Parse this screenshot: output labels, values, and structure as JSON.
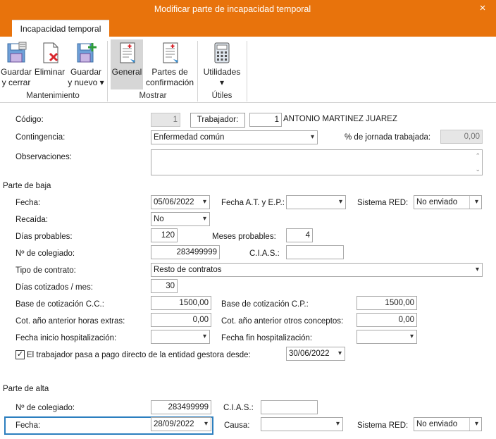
{
  "window": {
    "title": "Modificar parte de incapacidad temporal",
    "close_icon": "×"
  },
  "ribbon": {
    "tab": "Incapacidad temporal",
    "buttons": {
      "guardar_cerrar": [
        "Guardar",
        "y cerrar"
      ],
      "eliminar": [
        "Eliminar"
      ],
      "guardar_nuevo": [
        "Guardar",
        "y nuevo ▾"
      ],
      "general": [
        "General"
      ],
      "partes": [
        "Partes de",
        "confirmación"
      ],
      "utilidades": [
        "Utilidades",
        "▾"
      ]
    },
    "groups": {
      "mantenimiento": "Mantenimiento",
      "mostrar": "Mostrar",
      "utiles": "Útiles"
    }
  },
  "form": {
    "codigo_label": "Código:",
    "codigo_value": "1",
    "trabajador_button": "Trabajador:",
    "trabajador_id": "1",
    "trabajador_name": "ANTONIO MARTINEZ JUAREZ",
    "contingencia_label": "Contingencia:",
    "contingencia_value": "Enfermedad común",
    "jornada_label": "% de jornada trabajada:",
    "jornada_value": "0,00",
    "observaciones_label": "Observaciones:"
  },
  "baja": {
    "section": "Parte de baja",
    "fecha_label": "Fecha:",
    "fecha_value": "05/06/2022",
    "fecha_at_label": "Fecha A.T. y E.P.:",
    "fecha_at_value": "",
    "sistema_red_label": "Sistema RED:",
    "sistema_red_value": "No enviado",
    "recaida_label": "Recaída:",
    "recaida_value": "No",
    "dias_probables_label": "Días probables:",
    "dias_probables_value": "120",
    "meses_probables_label": "Meses probables:",
    "meses_probables_value": "4",
    "colegiado_label": "Nº de colegiado:",
    "colegiado_value": "283499999",
    "cias_label": "C.I.A.S.:",
    "cias_value": "",
    "tipo_contrato_label": "Tipo de contrato:",
    "tipo_contrato_value": "Resto de contratos",
    "dias_cotizados_label": "Días cotizados / mes:",
    "dias_cotizados_value": "30",
    "base_cc_label": "Base de cotización C.C.:",
    "base_cc_value": "1500,00",
    "base_cp_label": "Base de cotización C.P.:",
    "base_cp_value": "1500,00",
    "horas_extras_label": "Cot. año anterior horas extras:",
    "horas_extras_value": "0,00",
    "otros_conceptos_label": "Cot. año anterior otros conceptos:",
    "otros_conceptos_value": "0,00",
    "inicio_hosp_label": "Fecha inicio hospitalización:",
    "inicio_hosp_value": "",
    "fin_hosp_label": "Fecha fin hospitalización:",
    "fin_hosp_value": "",
    "pago_directo_label": "El trabajador pasa a pago directo de la entidad gestora desde:",
    "pago_directo_checked": "✓",
    "pago_directo_value": "30/06/2022"
  },
  "alta": {
    "section": "Parte de alta",
    "colegiado_label": "Nº de colegiado:",
    "colegiado_value": "283499999",
    "cias_label": "C.I.A.S.:",
    "cias_value": "",
    "fecha_label": "Fecha:",
    "fecha_value": "28/09/2022",
    "causa_label": "Causa:",
    "causa_value": "",
    "sistema_red_label": "Sistema RED:",
    "sistema_red_value": "No enviado"
  }
}
